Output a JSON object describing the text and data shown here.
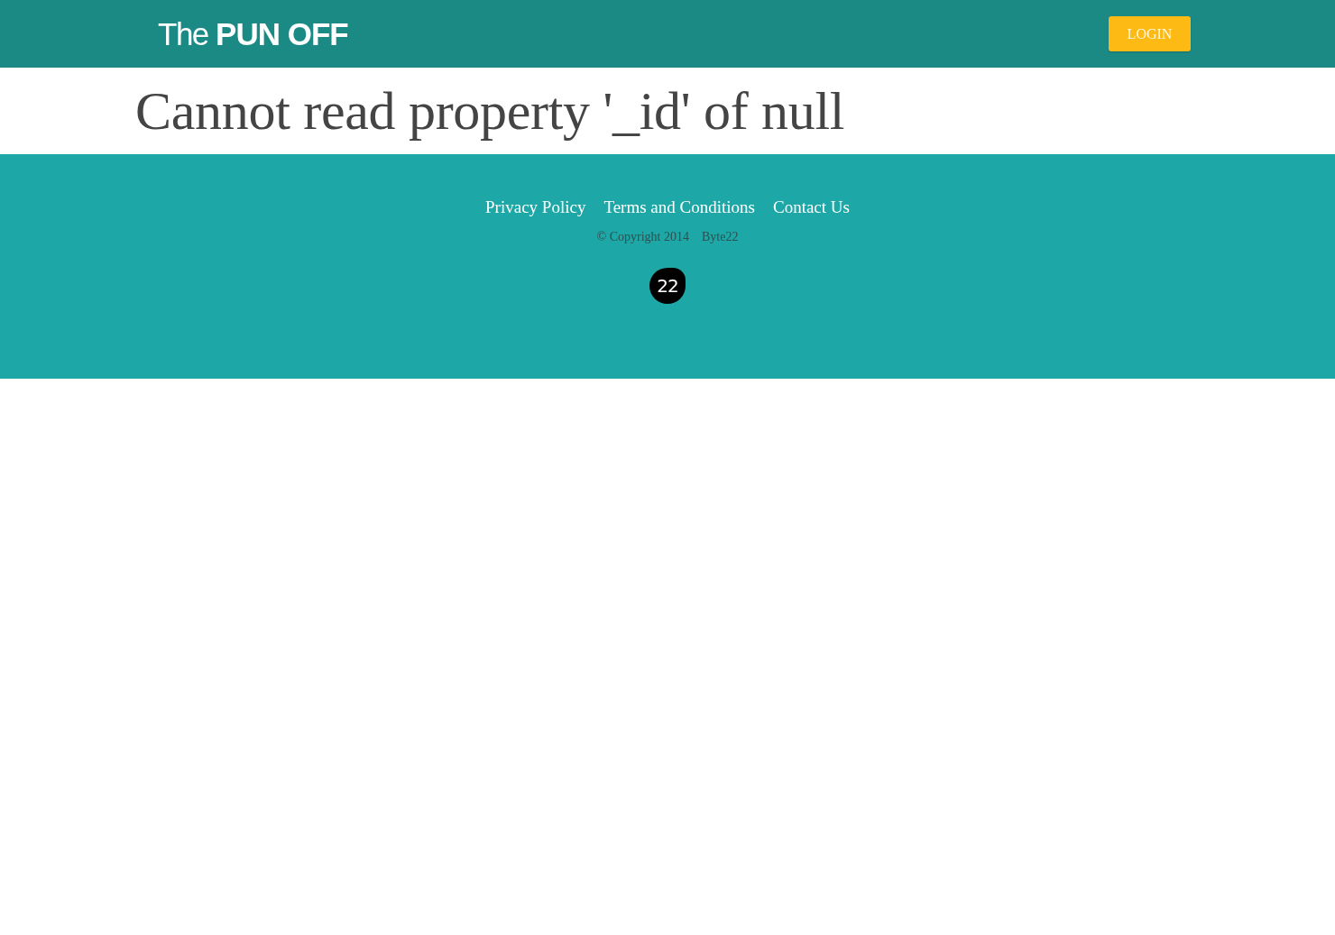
{
  "header": {
    "logo": "The **PUN OFF**",
    "login_button": "LOGIN"
  },
  "error": {
    "message": "Cannot read property '_id' of null"
  },
  "footer": {
    "links": [
      "Privacy Policy",
      "Terms and Conditions",
      "Contact Us"
    ],
    "copyright": "© Copyright 2014",
    "company": "Byte22",
    "badge": "22"
  }
}
